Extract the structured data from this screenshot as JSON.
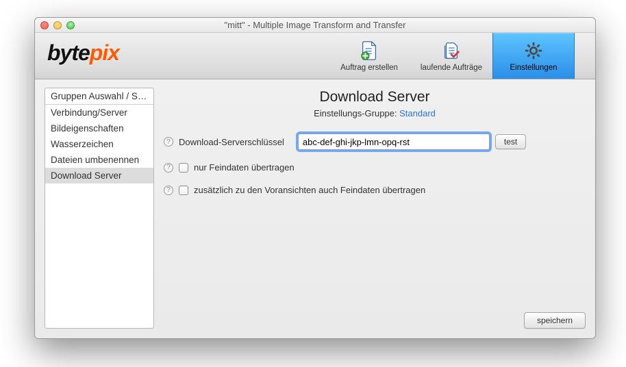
{
  "window": {
    "title": "\"mitt\" - Multiple Image Transform and Transfer"
  },
  "logo": {
    "byte": "byte",
    "pix": "pix"
  },
  "toolbar": {
    "create": "Auftrag erstellen",
    "running": "laufende Aufträge",
    "settings": "Einstellungen"
  },
  "sidebar": {
    "items": [
      "Gruppen Auswahl / Sy...",
      "Verbindung/Server",
      "Bildeigenschaften",
      "Wasserzeichen",
      "Dateien umbenennen",
      "Download Server"
    ],
    "selected_index": 5
  },
  "main": {
    "heading": "Download Server",
    "group_label": "Einstellungs-Gruppe: ",
    "group_link": "Standard",
    "key_label": "Download-Serverschlüssel",
    "key_value": "abc-def-ghi-jkp-lmn-opq-rst",
    "test_label": "test",
    "opt_fine_only": "nur Feindaten übertragen",
    "opt_fine_also": "zusätzlich zu den Voransichten auch Feindaten übertragen",
    "save_label": "speichern"
  }
}
